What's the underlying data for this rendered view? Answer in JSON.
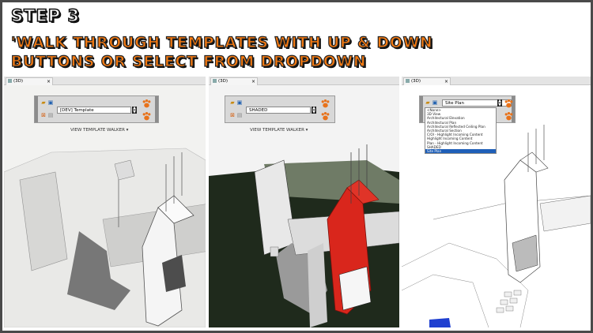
{
  "heading": {
    "step": "STEP 3",
    "line1": "'WALK THROUGH TEMPLATES WITH UP & DOWN",
    "line2": "BUTTONS OR SELECT FROM DROPDOWN"
  },
  "colors": {
    "accent": "#f47a12",
    "highlight": "#d9261c",
    "selection": "#1f5fb8"
  },
  "panels": [
    {
      "tab": "(3D)",
      "close": "×",
      "template": "[DEV] Template",
      "caption": "VIEW TEMPLATE WALKER ▾"
    },
    {
      "tab": "(3D)",
      "close": "×",
      "template": "SHADED",
      "caption": "VIEW TEMPLATE WALKER ▾"
    },
    {
      "tab": "(3D)",
      "close": "×",
      "template": "Site Plan",
      "dropdown": [
        "<None>",
        "3D View",
        "Architectural Elevation",
        "Architectural Plan",
        "Architectural Reflected Ceiling Plan",
        "Architectural Section",
        "C/OI - Highlight Incoming Content",
        "Highlight Incoming Content",
        "Plan - Highlight Incoming Content",
        "SHADED",
        "Site Plan"
      ],
      "selected_index": 10
    }
  ]
}
